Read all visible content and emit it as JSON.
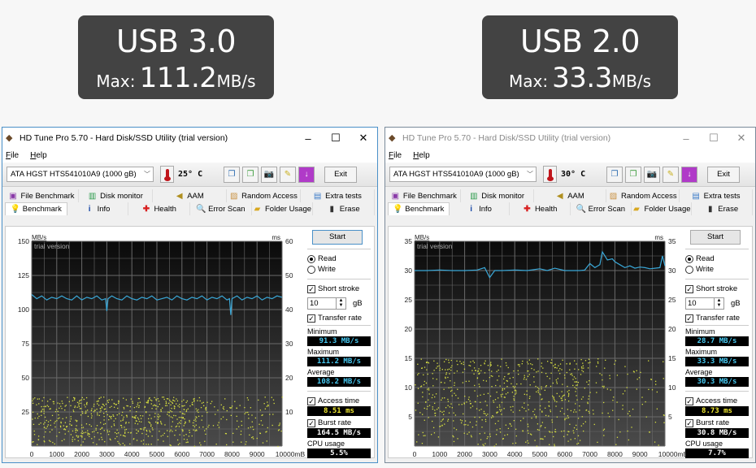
{
  "badges": [
    {
      "title": "USB 3.0",
      "max_label": "Max:",
      "max_value": "111.2",
      "unit": "MB/s"
    },
    {
      "title": "USB 2.0",
      "max_label": "Max:",
      "max_value": "33.3",
      "unit": "MB/s"
    }
  ],
  "windows": [
    {
      "title": "HD Tune Pro 5.70 - Hard Disk/SSD Utility (trial version)",
      "controls": {
        "minimize": "–",
        "maximize": "☐",
        "close": "✕"
      },
      "menu": [
        "File",
        "Help"
      ],
      "drive": "ATA    HGST HTS541010A9 (1000 gB)",
      "temperature": "25° C",
      "exit_label": "Exit",
      "tabs_row1": [
        "File Benchmark",
        "Disk monitor",
        "AAM",
        "Random Access",
        "Extra tests"
      ],
      "tabs_row2": [
        "Benchmark",
        "Info",
        "Health",
        "Error Scan",
        "Folder Usage",
        "Erase"
      ],
      "active_tab": "Benchmark",
      "start_label": "Start",
      "read_label": "Read",
      "write_label": "Write",
      "mode": "Read",
      "short_stroke_label": "Short stroke",
      "short_stroke_checked": true,
      "short_stroke_value": "10",
      "short_stroke_unit": "gB",
      "transfer_rate_label": "Transfer rate",
      "transfer_rate_checked": true,
      "minimum_label": "Minimum",
      "minimum": "91.3 MB/s",
      "maximum_label": "Maximum",
      "maximum": "111.2 MB/s",
      "average_label": "Average",
      "average": "108.2 MB/s",
      "access_time_label": "Access time",
      "access_time_checked": true,
      "access_time": "8.51 ms",
      "burst_rate_label": "Burst rate",
      "burst_rate_checked": true,
      "burst_rate": "164.5 MB/s",
      "cpu_usage_label": "CPU usage",
      "cpu_usage": "5.5%"
    },
    {
      "title": "HD Tune Pro 5.70 - Hard Disk/SSD Utility (trial version)",
      "controls": {
        "minimize": "–",
        "maximize": "☐",
        "close": "✕"
      },
      "menu": [
        "File",
        "Help"
      ],
      "drive": "ATA    HGST HTS541010A9 (1000 gB)",
      "temperature": "30° C",
      "exit_label": "Exit",
      "tabs_row1": [
        "File Benchmark",
        "Disk monitor",
        "AAM",
        "Random Access",
        "Extra tests"
      ],
      "tabs_row2": [
        "Benchmark",
        "Info",
        "Health",
        "Error Scan",
        "Folder Usage",
        "Erase"
      ],
      "active_tab": "Benchmark",
      "start_label": "Start",
      "read_label": "Read",
      "write_label": "Write",
      "mode": "Read",
      "short_stroke_label": "Short stroke",
      "short_stroke_checked": true,
      "short_stroke_value": "10",
      "short_stroke_unit": "gB",
      "transfer_rate_label": "Transfer rate",
      "transfer_rate_checked": true,
      "minimum_label": "Minimum",
      "minimum": "28.7 MB/s",
      "maximum_label": "Maximum",
      "maximum": "33.3 MB/s",
      "average_label": "Average",
      "average": "30.3 MB/s",
      "access_time_label": "Access time",
      "access_time_checked": true,
      "access_time": "8.73 ms",
      "burst_rate_label": "Burst rate",
      "burst_rate_checked": true,
      "burst_rate": "30.8 MB/s",
      "cpu_usage_label": "CPU usage",
      "cpu_usage": "7.7%"
    }
  ],
  "chart_data": [
    {
      "type": "line",
      "title": "",
      "watermark": "trial version",
      "xlabel": "mB",
      "ylabel": "MB/s",
      "y2label": "ms",
      "xlim": [
        0,
        10000
      ],
      "ylim": [
        0,
        150
      ],
      "y2lim": [
        0,
        60
      ],
      "x_ticks": [
        "0",
        "1000",
        "2000",
        "3000",
        "4000",
        "5000",
        "6000",
        "7000",
        "8000",
        "9000",
        "10000mB"
      ],
      "y_ticks": [
        "25",
        "50",
        "75",
        "100",
        "125",
        "150"
      ],
      "y2_ticks": [
        "10",
        "20",
        "30",
        "40",
        "50",
        "60"
      ],
      "grid": true,
      "series": [
        {
          "name": "Transfer rate",
          "color": "#3aa8d8",
          "x": [
            0,
            200,
            400,
            600,
            800,
            1000,
            1200,
            1400,
            1600,
            1800,
            2000,
            2200,
            2400,
            2600,
            2800,
            2950,
            3000,
            3050,
            3200,
            3400,
            3600,
            3800,
            4000,
            4200,
            4400,
            4600,
            4800,
            5000,
            5200,
            5400,
            5600,
            5800,
            6000,
            6200,
            6400,
            6600,
            6800,
            7000,
            7200,
            7400,
            7600,
            7800,
            7900,
            7950,
            8000,
            8200,
            8400,
            8600,
            8800,
            9000,
            9200,
            9400,
            9600,
            9800,
            10000
          ],
          "y": [
            111,
            108,
            110,
            107,
            109,
            108,
            110,
            108,
            107,
            110,
            107,
            109,
            108,
            110,
            107,
            108,
            99,
            108,
            110,
            108,
            107,
            110,
            108,
            107,
            109,
            108,
            110,
            107,
            108,
            109,
            107,
            110,
            108,
            107,
            109,
            108,
            110,
            107,
            109,
            108,
            110,
            107,
            108,
            96,
            108,
            110,
            107,
            109,
            108,
            110,
            107,
            109,
            108,
            110,
            109
          ]
        },
        {
          "name": "Access time",
          "color": "#d8e040",
          "type": "scatter",
          "y_axis": "ms",
          "spread_range": [
            0,
            14.5
          ]
        }
      ]
    },
    {
      "type": "line",
      "title": "",
      "watermark": "trial version",
      "xlabel": "mB",
      "ylabel": "MB/s",
      "y2label": "ms",
      "xlim": [
        0,
        10000
      ],
      "ylim": [
        0,
        35
      ],
      "y2lim": [
        0,
        35
      ],
      "x_ticks": [
        "0",
        "1000",
        "2000",
        "3000",
        "4000",
        "5000",
        "6000",
        "7000",
        "8000",
        "9000",
        "10000mB"
      ],
      "y_ticks": [
        "5",
        "10",
        "15",
        "20",
        "25",
        "30",
        "35"
      ],
      "y2_ticks": [
        "5",
        "10",
        "15",
        "20",
        "25",
        "30",
        "35"
      ],
      "grid": true,
      "series": [
        {
          "name": "Transfer rate",
          "color": "#3aa8d8",
          "x": [
            0,
            500,
            1000,
            1500,
            2000,
            2500,
            2800,
            3000,
            3200,
            3500,
            4000,
            4500,
            5000,
            5300,
            5600,
            6000,
            6300,
            6600,
            6800,
            7000,
            7200,
            7400,
            7500,
            7700,
            7900,
            8000,
            8200,
            8400,
            8600,
            8800,
            9000,
            9200,
            9400,
            9600,
            9800,
            9900,
            10000
          ],
          "y": [
            30,
            30,
            30.1,
            30,
            30,
            30.1,
            30.5,
            28.8,
            30,
            30,
            30.1,
            30,
            30.3,
            30,
            30.4,
            30,
            30,
            30,
            30.1,
            31.2,
            30.5,
            31,
            33.2,
            31.8,
            32,
            31.5,
            31,
            30.5,
            30.8,
            30.4,
            30.6,
            30.5,
            30.3,
            30.4,
            30.5,
            32.5,
            30.8
          ]
        },
        {
          "name": "Access time",
          "color": "#d8e040",
          "type": "scatter",
          "y_axis": "ms",
          "spread_range": [
            0,
            15
          ]
        }
      ]
    }
  ]
}
